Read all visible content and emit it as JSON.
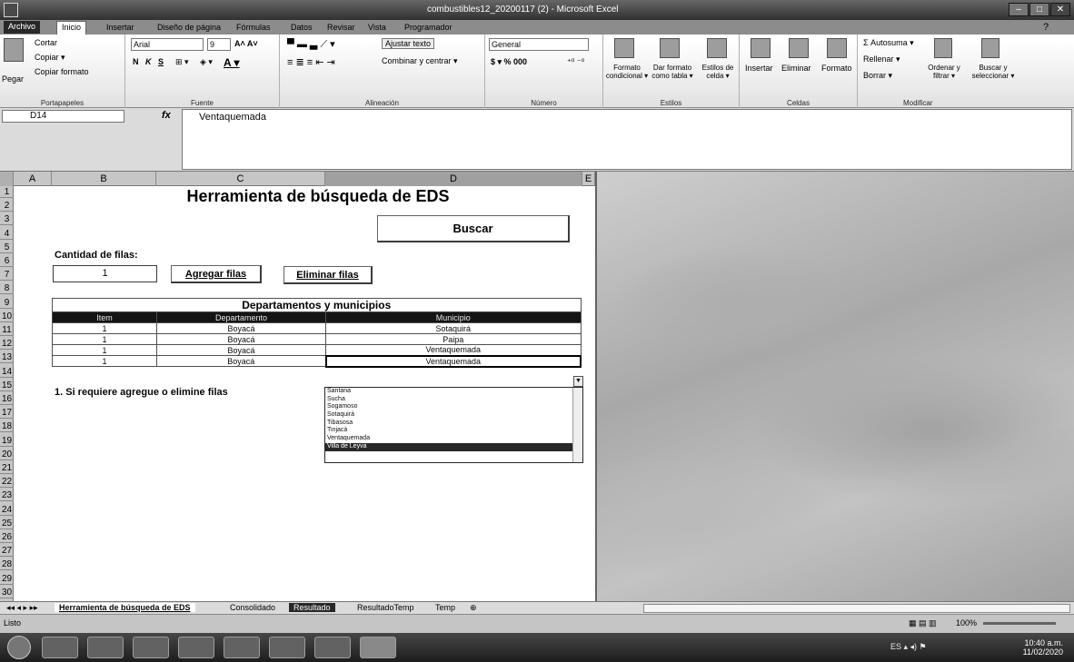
{
  "window": {
    "title": "combustibles12_20200117 (2) - Microsoft Excel"
  },
  "tabs": [
    "Archivo",
    "Inicio",
    "Insertar",
    "Diseño de página",
    "Fórmulas",
    "Datos",
    "Revisar",
    "Vista",
    "Programador"
  ],
  "ribbon": {
    "clipboard": {
      "paste": "Pegar",
      "cut": "Cortar",
      "copy": "Copiar ▾",
      "format_painter": "Copiar formato",
      "label": "Portapapeles"
    },
    "font": {
      "name": "Arial",
      "size": "9",
      "label": "Fuente",
      "bold": "N",
      "italic": "K",
      "underline": "S"
    },
    "alignment": {
      "wrap": "Ajustar texto",
      "merge": "Combinar y centrar ▾",
      "label": "Alineación"
    },
    "number": {
      "format": "General",
      "currency": "$ ▾ %  000",
      "label": "Número"
    },
    "styles": {
      "conditional": "Formato condicional ▾",
      "as_table": "Dar formato como tabla ▾",
      "cell_styles": "Estilos de celda ▾",
      "label": "Estilos"
    },
    "cells": {
      "insert": "Insertar",
      "delete": "Eliminar",
      "format": "Formato",
      "label": "Celdas"
    },
    "editing": {
      "autosum": "Σ Autosuma ▾",
      "fill": "Rellenar ▾",
      "clear": "Borrar ▾",
      "sort": "Ordenar y filtrar ▾",
      "find": "Buscar y seleccionar ▾",
      "label": "Modificar"
    }
  },
  "formula_bar": {
    "name_box": "D14",
    "fx": "fx",
    "value": "Ventaquemada"
  },
  "columns": [
    "A",
    "B",
    "C",
    "D",
    "E"
  ],
  "rows": [
    "1",
    "2",
    "3",
    "4",
    "5",
    "6",
    "7",
    "8",
    "9",
    "10",
    "11",
    "12",
    "13",
    "14",
    "15",
    "16",
    "17",
    "18",
    "19",
    "20",
    "21",
    "22",
    "23",
    "24",
    "25",
    "26",
    "27",
    "28",
    "29",
    "30"
  ],
  "sheet": {
    "heading": "Herramienta de búsqueda de EDS",
    "search_button": "Buscar",
    "rows_count_label": "Cantidad de filas:",
    "rows_count_value": "1",
    "add_rows_button": "Agregar filas",
    "remove_rows_button": "Eliminar filas",
    "table_title": "Departamentos y municipios",
    "table_headers": [
      "Item",
      "Departamento",
      "Municipio"
    ],
    "table_rows": [
      [
        "1",
        "Boyacá",
        "Sotaquirá"
      ],
      [
        "1",
        "Boyacá",
        "Paipa"
      ],
      [
        "1",
        "Boyacá",
        "Ventaquemada"
      ],
      [
        "1",
        "Boyacá",
        "Ventaquemada"
      ]
    ],
    "note": "1. Si requiere agregue o elimine filas"
  },
  "dropdown": {
    "options": [
      "Santana",
      "Sucha",
      "Sogamoso",
      "Sotaquirá",
      "Tibasosa",
      "Tinjacá",
      "Ventaquemada",
      "Villa de Leyva"
    ],
    "highlighted_index": 7
  },
  "sheet_tabs": [
    "Herramienta de búsqueda de EDS",
    "Consolidado",
    "Resultado",
    "ResultadoTemp",
    "Temp"
  ],
  "status": {
    "mode": "Listo",
    "zoom": "100%"
  },
  "clock": {
    "time": "10:40 a.m.",
    "date": "11/02/2020"
  }
}
